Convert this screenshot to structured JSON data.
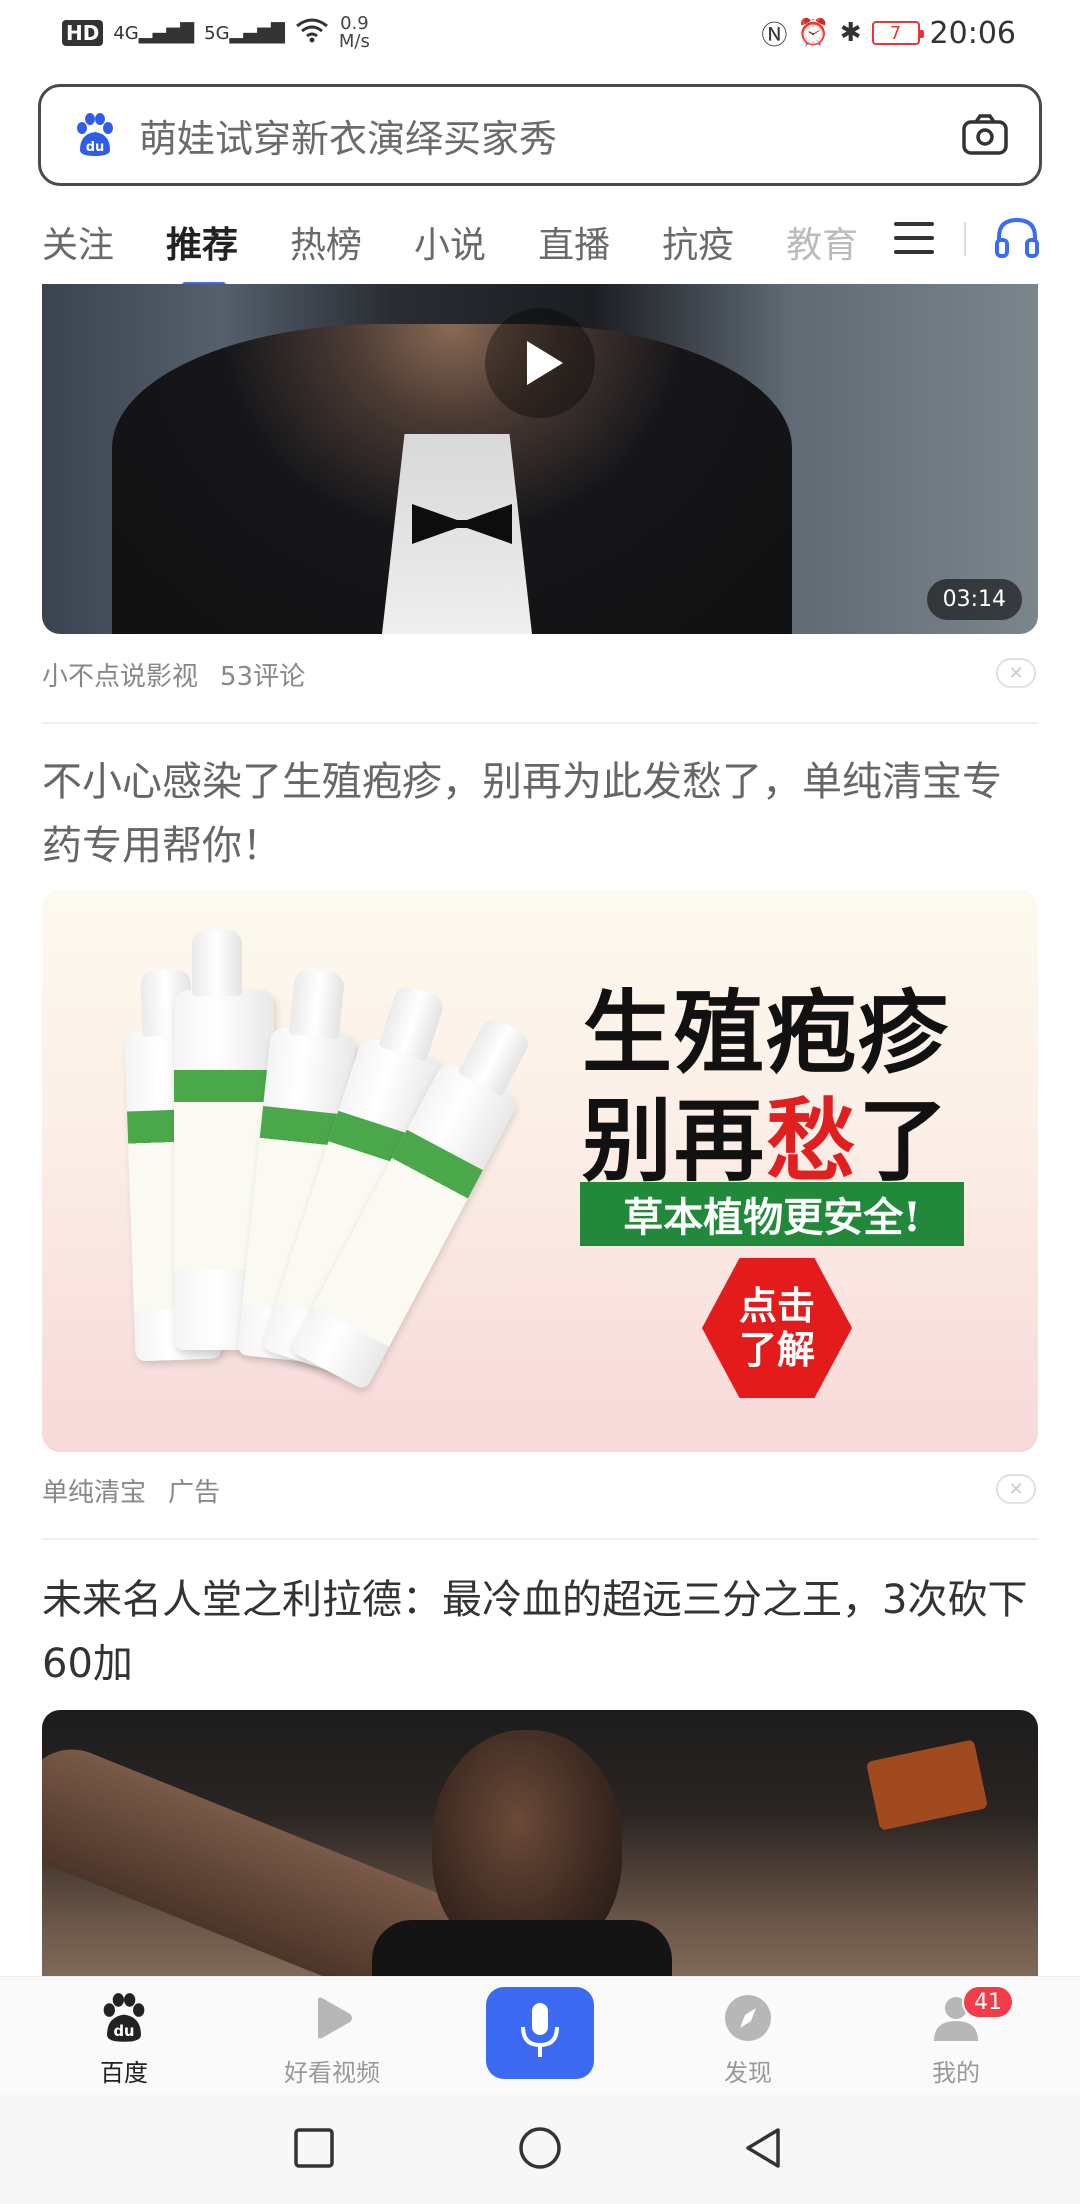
{
  "status_bar": {
    "hd_label": "HD",
    "net_4g": "4G",
    "net_5g": "5G",
    "speed_value": "0.9",
    "speed_unit": "M/s",
    "battery": "7",
    "time": "20:06"
  },
  "search": {
    "placeholder": "萌娃试穿新衣演绎买家秀"
  },
  "tabs": [
    {
      "label": "关注"
    },
    {
      "label": "推荐"
    },
    {
      "label": "热榜"
    },
    {
      "label": "小说"
    },
    {
      "label": "直播"
    },
    {
      "label": "抗疫"
    },
    {
      "label": "教育"
    }
  ],
  "feed": {
    "video1": {
      "duration": "03:14",
      "source": "小不点说影视",
      "comments": "53评论"
    },
    "ad": {
      "title": "不小心感染了生殖疱疹，别再为此发愁了，单纯清宝专药专用帮你！",
      "headline1": "生殖疱疹",
      "headline2_pre": "别再",
      "headline2_red": "愁",
      "headline2_post": "了",
      "green_banner": "草本植物更安全!",
      "cta_line1": "点击",
      "cta_line2": "了解",
      "advertiser": "单纯清宝",
      "ad_tag": "广告"
    },
    "article2": {
      "title": "未来名人堂之利拉德：最冷血的超远三分之王，3次砍下60加"
    }
  },
  "bottom_nav": {
    "items": [
      {
        "label": "百度",
        "icon": "baidu-paw-icon"
      },
      {
        "label": "好看视频",
        "icon": "play-icon"
      },
      {
        "label": "发现",
        "icon": "compass-icon"
      },
      {
        "label": "我的",
        "icon": "user-icon"
      }
    ],
    "badge": "41",
    "accent": "#3d6af3"
  }
}
